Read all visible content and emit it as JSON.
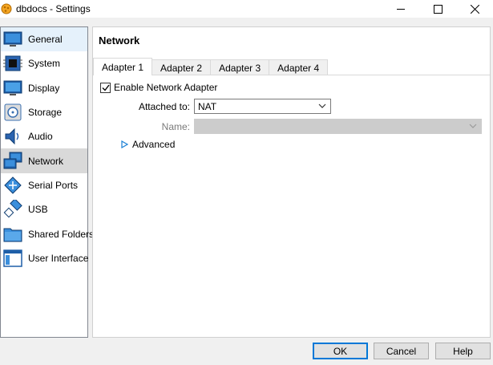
{
  "window": {
    "title": "dbdocs - Settings"
  },
  "sidebar": {
    "items": [
      {
        "label": "General",
        "icon": "general-icon"
      },
      {
        "label": "System",
        "icon": "system-icon"
      },
      {
        "label": "Display",
        "icon": "display-icon"
      },
      {
        "label": "Storage",
        "icon": "storage-icon"
      },
      {
        "label": "Audio",
        "icon": "audio-icon"
      },
      {
        "label": "Network",
        "icon": "network-icon"
      },
      {
        "label": "Serial Ports",
        "icon": "serial-ports-icon"
      },
      {
        "label": "USB",
        "icon": "usb-icon"
      },
      {
        "label": "Shared Folders",
        "icon": "shared-folders-icon"
      },
      {
        "label": "User Interface",
        "icon": "user-interface-icon"
      }
    ],
    "selected": "Network",
    "hovered": "General"
  },
  "main": {
    "section_title": "Network",
    "tabs": [
      {
        "label": "Adapter 1"
      },
      {
        "label": "Adapter 2"
      },
      {
        "label": "Adapter 3"
      },
      {
        "label": "Adapter 4"
      }
    ],
    "active_tab": "Adapter 1",
    "enable_adapter": {
      "label": "Enable Network Adapter",
      "checked": true
    },
    "attached_to": {
      "label": "Attached to:",
      "value": "NAT"
    },
    "name": {
      "label": "Name:",
      "value": ""
    },
    "advanced_label": "Advanced"
  },
  "buttons": {
    "ok": "OK",
    "cancel": "Cancel",
    "help": "Help"
  },
  "colors": {
    "accent": "#0078d7",
    "selected_bg": "#d9d9d9",
    "hover_bg": "#e5f1fb"
  }
}
